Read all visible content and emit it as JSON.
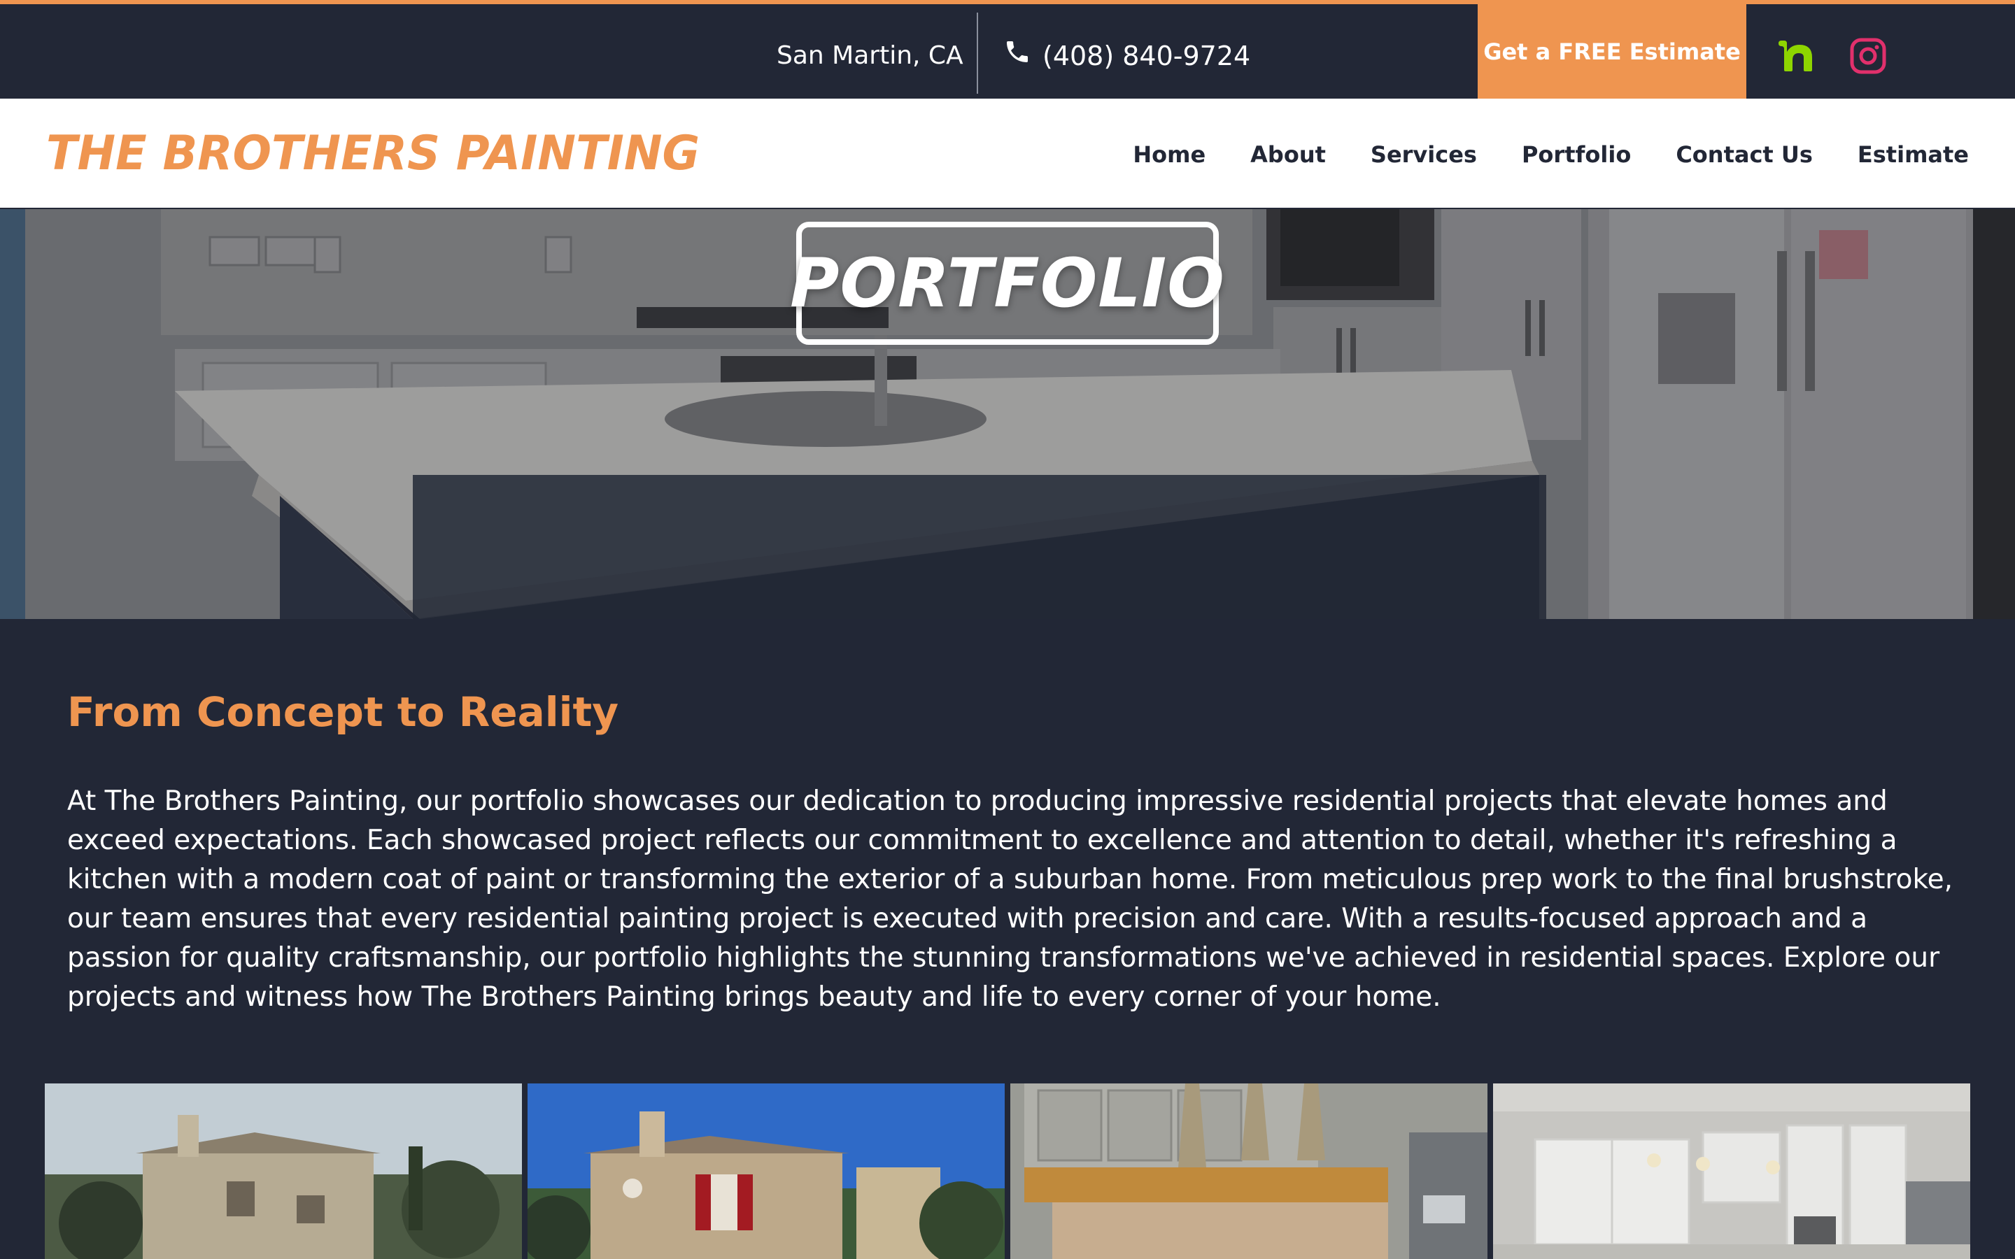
{
  "topbar": {
    "location": "San Martin, CA",
    "phone": "(408) 840-9724",
    "estimate_button": "Get a FREE Estimate",
    "social": [
      "nextdoor-icon",
      "instagram-icon"
    ]
  },
  "header": {
    "logo": "THE BROTHERS PAINTING",
    "nav": [
      "Home",
      "About",
      "Services",
      "Portfolio",
      "Contact Us",
      "Estimate"
    ]
  },
  "hero": {
    "title": "PORTFOLIO"
  },
  "content": {
    "heading": "From Concept to Reality",
    "body": "At The Brothers Painting, our portfolio showcases our dedication to producing impressive residential projects that elevate homes and exceed expectations. Each showcased project reflects our commitment to excellence and attention to detail, whether it's refreshing a kitchen with a modern coat of paint or transforming the exterior of a suburban home. From meticulous prep work to the final brushstroke, our team ensures that every residential painting project is executed with precision and care. With a results-focused approach and a passion for quality craftsmanship, our portfolio highlights the stunning transformations we've achieved in residential spaces. Explore our projects and witness how The Brothers Painting brings beauty and life to every corner of your home."
  },
  "colors": {
    "accent": "#ef9550",
    "dark": "#222736",
    "nextdoor": "#8ed500",
    "instagram": "#e1306c"
  }
}
